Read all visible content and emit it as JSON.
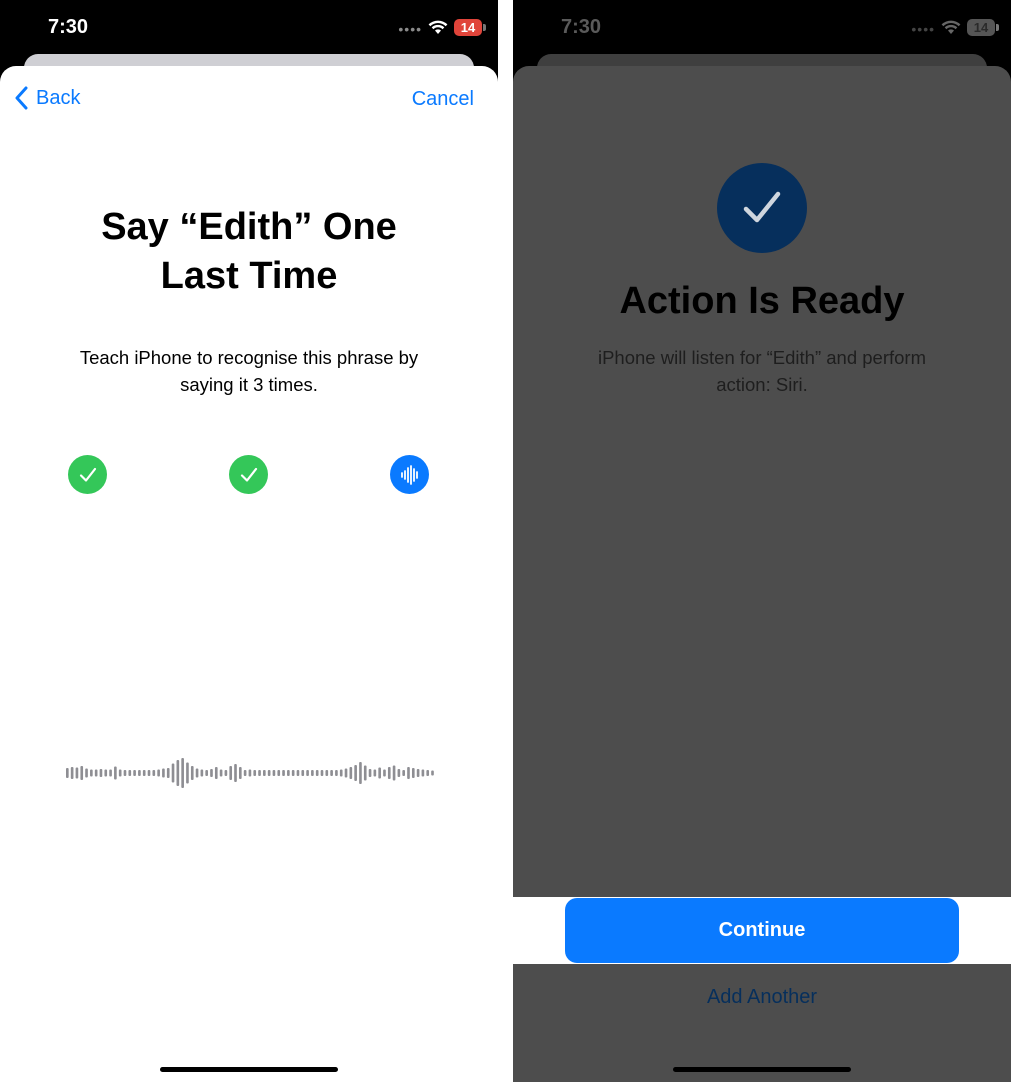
{
  "left_screen": {
    "status": {
      "time": "7:30",
      "battery": "14"
    },
    "nav": {
      "back_label": "Back",
      "cancel_label": "Cancel"
    },
    "title_line1": "Say “Edith” One",
    "title_line2": "Last Time",
    "subtitle_line1": "Teach iPhone to recognise this phrase by",
    "subtitle_line2": "saying it 3 times.",
    "progress": [
      {
        "state": "done",
        "icon": "checkmark-icon"
      },
      {
        "state": "done",
        "icon": "checkmark-icon"
      },
      {
        "state": "listening",
        "icon": "waveform-icon"
      }
    ],
    "waveform_icon": "audio-waveform-icon"
  },
  "right_screen": {
    "status": {
      "time": "7:30",
      "battery": "14"
    },
    "icon": "checkmark-circle-icon",
    "title": "Action Is Ready",
    "subtitle_line1": "iPhone will listen for “Edith” and perform",
    "subtitle_line2": "action: Siri.",
    "continue_label": "Continue",
    "add_another_label": "Add Another"
  },
  "colors": {
    "accent_blue": "#0a7aff",
    "success_green": "#34c759",
    "dim_overlay": "#4d4d4d",
    "battery_red": "#e0443a"
  }
}
